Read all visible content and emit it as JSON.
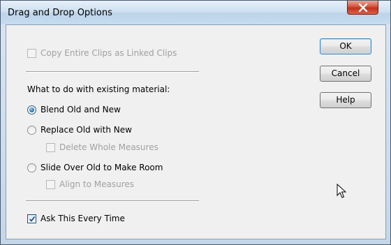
{
  "window": {
    "title": "Drag and Drop Options",
    "close_symbol": "X"
  },
  "options": {
    "copy_linked": {
      "label": "Copy Entire Clips as Linked Clips",
      "checked": false,
      "enabled": false
    },
    "group_label": "What to do with existing material:",
    "blend": {
      "label": "Blend Old and New",
      "selected": true
    },
    "replace": {
      "label": "Replace Old with New",
      "selected": false
    },
    "delete_whole": {
      "label": "Delete Whole Measures",
      "checked": false,
      "enabled": false
    },
    "slide_over": {
      "label": "Slide Over Old to Make Room",
      "selected": false
    },
    "align_measures": {
      "label": "Align to Measures",
      "checked": false,
      "enabled": false
    },
    "ask_every_time": {
      "label": "Ask This Every Time",
      "checked": true,
      "enabled": true
    }
  },
  "buttons": {
    "ok": "OK",
    "cancel": "Cancel",
    "help": "Help"
  },
  "colors": {
    "close_button": "#c2301b",
    "radio_selected": "#2a78c2",
    "default_button_border": "#3c7fb1",
    "dialog_background": "#f0f0f0"
  },
  "icons": {
    "close": "close-icon",
    "check": "checkmark-icon",
    "cursor": "mouse-pointer-icon"
  }
}
